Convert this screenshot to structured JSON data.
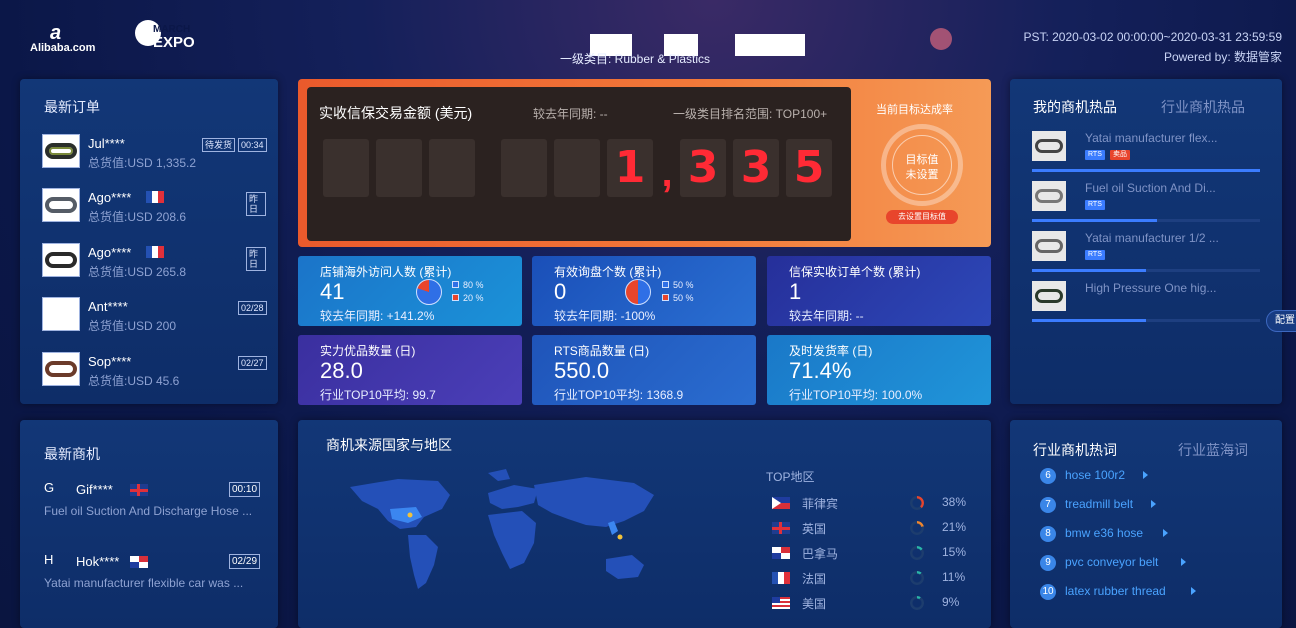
{
  "header": {
    "alibaba_logo": "Alibaba.com",
    "expo_line1": "MARCH",
    "expo_line2": "EXPO",
    "category": "一级类目: Rubber & Plastics",
    "date_range": "PST: 2020-03-02 00:00:00~2020-03-31 23:59:59",
    "powered_by": "Powered by: 数据管家"
  },
  "latest_orders": {
    "title": "最新订单",
    "items": [
      {
        "name": "Jul****",
        "value": "总货值:USD 1,335.2",
        "badge1": "待发货",
        "badge2": "00:34",
        "flag": ""
      },
      {
        "name": "Ago****",
        "value": "总货值:USD 208.6",
        "badge1": "",
        "badge2": "昨日",
        "flag": "fr"
      },
      {
        "name": "Ago****",
        "value": "总货值:USD 265.8",
        "badge1": "",
        "badge2": "昨日",
        "flag": "fr"
      },
      {
        "name": "Ant****",
        "value": "总货值:USD 200",
        "badge1": "",
        "badge2": "02/28",
        "flag": ""
      },
      {
        "name": "Sop****",
        "value": "总货值:USD 45.6",
        "badge1": "",
        "badge2": "02/27",
        "flag": ""
      }
    ]
  },
  "transaction": {
    "title": "实收信保交易金额 (美元)",
    "yoy": "较去年同期: --",
    "rank": "一级类目排名范围: TOP100+",
    "digits": [
      "1",
      ",",
      "3",
      "3",
      "5"
    ],
    "target_label": "当前目标达成率",
    "target_line1": "目标值",
    "target_line2": "未设置",
    "target_button": "去设置目标值"
  },
  "kpis": [
    {
      "title": "店铺海外访问人数 (累计)",
      "value": "41",
      "footer": "较去年同期: +141.2%",
      "legend1": "80 %",
      "legend2": "20 %",
      "pie": 0.8
    },
    {
      "title": "有效询盘个数 (累计)",
      "value": "0",
      "footer": "较去年同期: -100%",
      "legend1": "50 %",
      "legend2": "50 %",
      "pie": 0.5
    },
    {
      "title": "信保实收订单个数 (累计)",
      "value": "1",
      "footer": "较去年同期: --"
    },
    {
      "title": "实力优品数量 (日)",
      "value": "28.0",
      "footer": "行业TOP10平均: 99.7"
    },
    {
      "title": "RTS商品数量 (日)",
      "value": "550.0",
      "footer": "行业TOP10平均: 1368.9"
    },
    {
      "title": "及时发货率 (日)",
      "value": "71.4%",
      "footer": "行业TOP10平均: 100.0%"
    }
  ],
  "hot_products": {
    "tab_active": "我的商机热品",
    "tab_inactive": "行业商机热品",
    "items": [
      {
        "title": "Yatai manufacturer flex...",
        "tags": [
          "RTS",
          "卖品"
        ],
        "level": 1.0
      },
      {
        "title": "Fuel oil Suction And Di...",
        "tags": [
          "RTS"
        ],
        "level": 0.55
      },
      {
        "title": "Yatai manufacturer 1/2 ...",
        "tags": [
          "RTS"
        ],
        "level": 0.5
      },
      {
        "title": "High Pressure One hig...",
        "tags": [],
        "level": 0.5
      }
    ],
    "side_button": "配置"
  },
  "opportunities": {
    "title": "最新商机",
    "items": [
      {
        "letter": "G",
        "name": "Gif****",
        "time": "00:10",
        "flag": "uk",
        "desc": "Fuel oil Suction And Discharge Hose ..."
      },
      {
        "letter": "H",
        "name": "Hok****",
        "time": "02/29",
        "flag": "pa",
        "desc": "Yatai manufacturer flexible car was ..."
      }
    ]
  },
  "map": {
    "title": "商机来源国家与地区",
    "top_label": "TOP地区",
    "regions": [
      {
        "name": "菲律宾",
        "percent": "38%",
        "flag": "ph",
        "color": "#e8452c",
        "share": 0.38
      },
      {
        "name": "英国",
        "percent": "21%",
        "flag": "uk",
        "color": "#f0862c",
        "share": 0.21
      },
      {
        "name": "巴拿马",
        "percent": "15%",
        "flag": "pa",
        "color": "#2ab6a8",
        "share": 0.15
      },
      {
        "name": "法国",
        "percent": "11%",
        "flag": "fr",
        "color": "#2ab6a8",
        "share": 0.11
      },
      {
        "name": "美国",
        "percent": "9%",
        "flag": "us",
        "color": "#2ab6a8",
        "share": 0.09
      }
    ]
  },
  "keywords": {
    "tab_active": "行业商机热词",
    "tab_inactive": "行业蓝海词",
    "items": [
      {
        "num": "6",
        "text": "hose 100r2"
      },
      {
        "num": "7",
        "text": "treadmill belt"
      },
      {
        "num": "8",
        "text": "bmw e36 hose"
      },
      {
        "num": "9",
        "text": "pvc conveyor belt"
      },
      {
        "num": "10",
        "text": "latex rubber thread"
      }
    ]
  }
}
